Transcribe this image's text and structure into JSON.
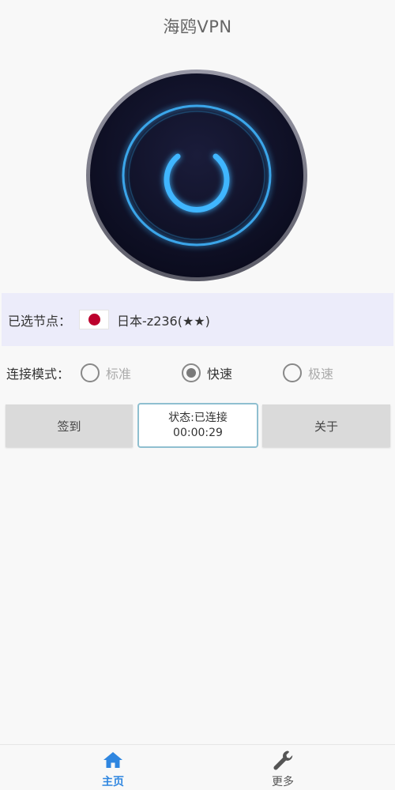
{
  "app": {
    "title": "海鸥VPN"
  },
  "node": {
    "label": "已选节点：",
    "name": "日本-z236(★★)"
  },
  "mode": {
    "label": "连接模式：",
    "options": [
      "标准",
      "快速",
      "极速"
    ],
    "selected": "快速"
  },
  "actions": {
    "sign_label": "签到",
    "about_label": "关于"
  },
  "status": {
    "text": "状态:已连接",
    "timer": "00:00:29"
  },
  "nav": {
    "home_label": "主页",
    "more_label": "更多"
  },
  "colors": {
    "accent": "#2f86e0",
    "glow": "#3fb6ff",
    "node_bar": "#ececfa",
    "flag_red": "#bc002d"
  },
  "icons": {
    "power": "power-icon",
    "home": "home-icon",
    "more": "wrench-icon",
    "flag": "japan-flag-icon"
  }
}
